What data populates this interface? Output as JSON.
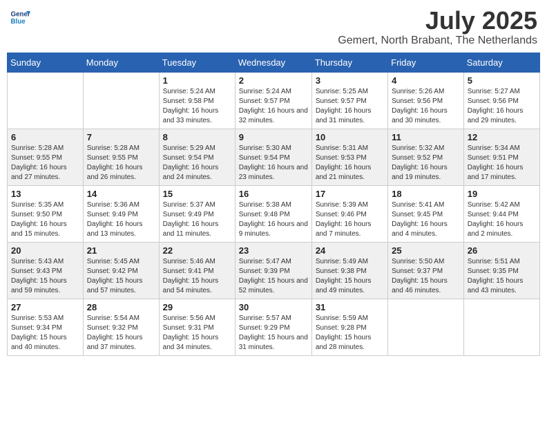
{
  "header": {
    "logo_line1": "General",
    "logo_line2": "Blue",
    "month": "July 2025",
    "location": "Gemert, North Brabant, The Netherlands"
  },
  "weekdays": [
    "Sunday",
    "Monday",
    "Tuesday",
    "Wednesday",
    "Thursday",
    "Friday",
    "Saturday"
  ],
  "weeks": [
    [
      {
        "day": "",
        "detail": ""
      },
      {
        "day": "",
        "detail": ""
      },
      {
        "day": "1",
        "detail": "Sunrise: 5:24 AM\nSunset: 9:58 PM\nDaylight: 16 hours and 33 minutes."
      },
      {
        "day": "2",
        "detail": "Sunrise: 5:24 AM\nSunset: 9:57 PM\nDaylight: 16 hours and 32 minutes."
      },
      {
        "day": "3",
        "detail": "Sunrise: 5:25 AM\nSunset: 9:57 PM\nDaylight: 16 hours and 31 minutes."
      },
      {
        "day": "4",
        "detail": "Sunrise: 5:26 AM\nSunset: 9:56 PM\nDaylight: 16 hours and 30 minutes."
      },
      {
        "day": "5",
        "detail": "Sunrise: 5:27 AM\nSunset: 9:56 PM\nDaylight: 16 hours and 29 minutes."
      }
    ],
    [
      {
        "day": "6",
        "detail": "Sunrise: 5:28 AM\nSunset: 9:55 PM\nDaylight: 16 hours and 27 minutes."
      },
      {
        "day": "7",
        "detail": "Sunrise: 5:28 AM\nSunset: 9:55 PM\nDaylight: 16 hours and 26 minutes."
      },
      {
        "day": "8",
        "detail": "Sunrise: 5:29 AM\nSunset: 9:54 PM\nDaylight: 16 hours and 24 minutes."
      },
      {
        "day": "9",
        "detail": "Sunrise: 5:30 AM\nSunset: 9:54 PM\nDaylight: 16 hours and 23 minutes."
      },
      {
        "day": "10",
        "detail": "Sunrise: 5:31 AM\nSunset: 9:53 PM\nDaylight: 16 hours and 21 minutes."
      },
      {
        "day": "11",
        "detail": "Sunrise: 5:32 AM\nSunset: 9:52 PM\nDaylight: 16 hours and 19 minutes."
      },
      {
        "day": "12",
        "detail": "Sunrise: 5:34 AM\nSunset: 9:51 PM\nDaylight: 16 hours and 17 minutes."
      }
    ],
    [
      {
        "day": "13",
        "detail": "Sunrise: 5:35 AM\nSunset: 9:50 PM\nDaylight: 16 hours and 15 minutes."
      },
      {
        "day": "14",
        "detail": "Sunrise: 5:36 AM\nSunset: 9:49 PM\nDaylight: 16 hours and 13 minutes."
      },
      {
        "day": "15",
        "detail": "Sunrise: 5:37 AM\nSunset: 9:49 PM\nDaylight: 16 hours and 11 minutes."
      },
      {
        "day": "16",
        "detail": "Sunrise: 5:38 AM\nSunset: 9:48 PM\nDaylight: 16 hours and 9 minutes."
      },
      {
        "day": "17",
        "detail": "Sunrise: 5:39 AM\nSunset: 9:46 PM\nDaylight: 16 hours and 7 minutes."
      },
      {
        "day": "18",
        "detail": "Sunrise: 5:41 AM\nSunset: 9:45 PM\nDaylight: 16 hours and 4 minutes."
      },
      {
        "day": "19",
        "detail": "Sunrise: 5:42 AM\nSunset: 9:44 PM\nDaylight: 16 hours and 2 minutes."
      }
    ],
    [
      {
        "day": "20",
        "detail": "Sunrise: 5:43 AM\nSunset: 9:43 PM\nDaylight: 15 hours and 59 minutes."
      },
      {
        "day": "21",
        "detail": "Sunrise: 5:45 AM\nSunset: 9:42 PM\nDaylight: 15 hours and 57 minutes."
      },
      {
        "day": "22",
        "detail": "Sunrise: 5:46 AM\nSunset: 9:41 PM\nDaylight: 15 hours and 54 minutes."
      },
      {
        "day": "23",
        "detail": "Sunrise: 5:47 AM\nSunset: 9:39 PM\nDaylight: 15 hours and 52 minutes."
      },
      {
        "day": "24",
        "detail": "Sunrise: 5:49 AM\nSunset: 9:38 PM\nDaylight: 15 hours and 49 minutes."
      },
      {
        "day": "25",
        "detail": "Sunrise: 5:50 AM\nSunset: 9:37 PM\nDaylight: 15 hours and 46 minutes."
      },
      {
        "day": "26",
        "detail": "Sunrise: 5:51 AM\nSunset: 9:35 PM\nDaylight: 15 hours and 43 minutes."
      }
    ],
    [
      {
        "day": "27",
        "detail": "Sunrise: 5:53 AM\nSunset: 9:34 PM\nDaylight: 15 hours and 40 minutes."
      },
      {
        "day": "28",
        "detail": "Sunrise: 5:54 AM\nSunset: 9:32 PM\nDaylight: 15 hours and 37 minutes."
      },
      {
        "day": "29",
        "detail": "Sunrise: 5:56 AM\nSunset: 9:31 PM\nDaylight: 15 hours and 34 minutes."
      },
      {
        "day": "30",
        "detail": "Sunrise: 5:57 AM\nSunset: 9:29 PM\nDaylight: 15 hours and 31 minutes."
      },
      {
        "day": "31",
        "detail": "Sunrise: 5:59 AM\nSunset: 9:28 PM\nDaylight: 15 hours and 28 minutes."
      },
      {
        "day": "",
        "detail": ""
      },
      {
        "day": "",
        "detail": ""
      }
    ]
  ]
}
